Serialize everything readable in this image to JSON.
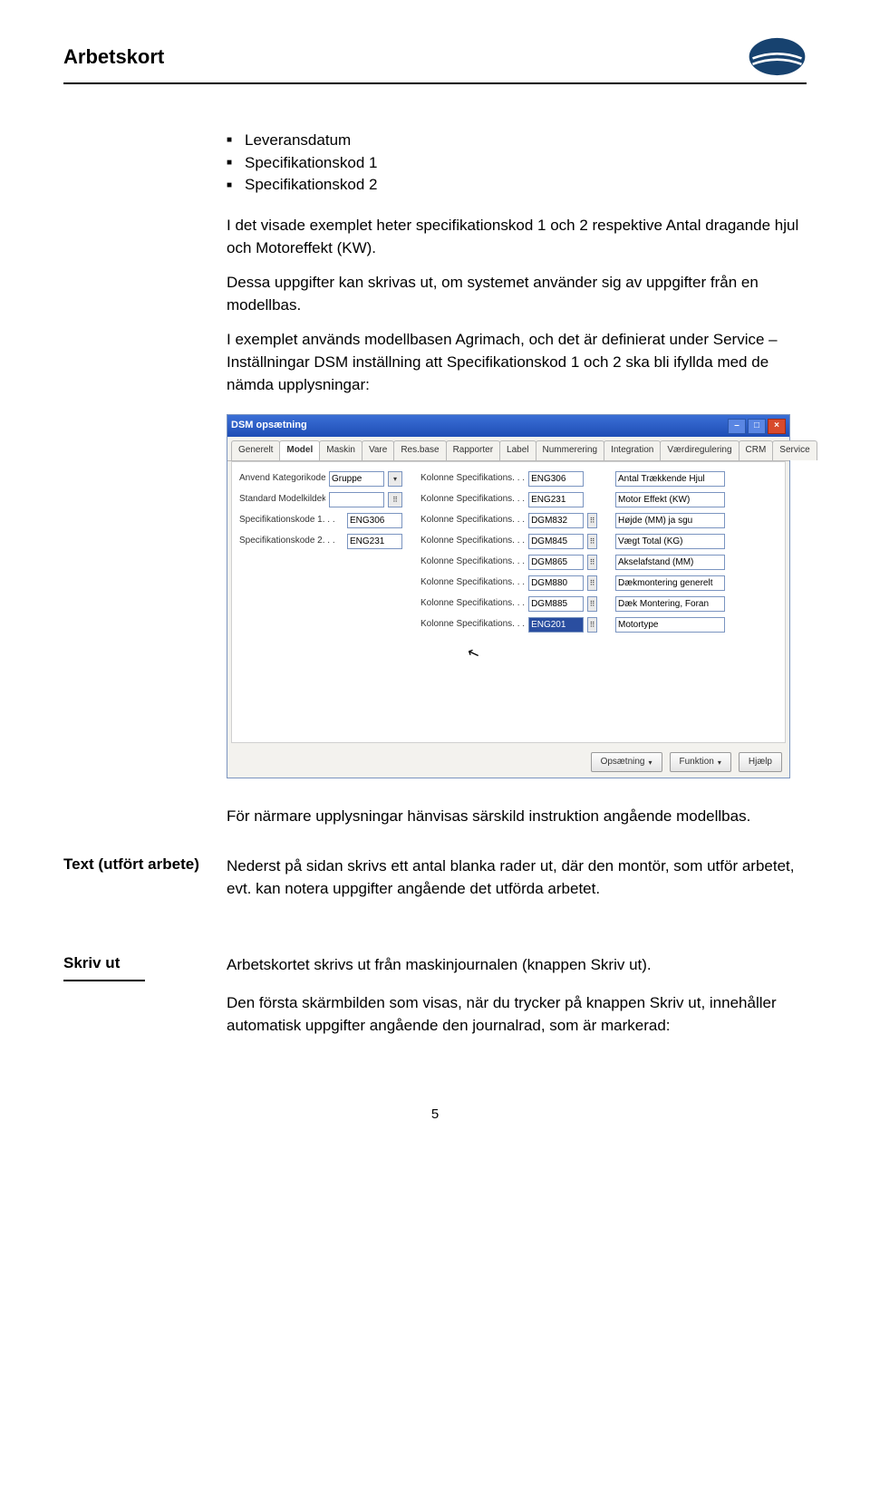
{
  "header": {
    "title": "Arbetskort"
  },
  "bullets": [
    "Leveransdatum",
    "Specifikationskod 1",
    "Specifikationskod 2"
  ],
  "para1": "I det visade exemplet heter specifikationskod 1 och 2 respektive Antal dragande hjul och Motoreffekt (KW).",
  "para2": "Dessa uppgifter kan skrivas ut, om systemet använder sig av uppgifter från en modellbas.",
  "para3": "I exemplet används modellbasen Agrimach, och det är definierat under Service – Inställningar DSM inställning att Specifikationskod 1 och 2 ska bli ifyllda med de nämda upplysningar:",
  "window": {
    "title": "DSM opsætning",
    "tabs": [
      "Generelt",
      "Model",
      "Maskin",
      "Vare",
      "Res.base",
      "Rapporter",
      "Label",
      "Nummerering",
      "Integration",
      "Værdiregulering",
      "CRM",
      "Service"
    ],
    "active_tab": "Model",
    "left_labels": {
      "row1": "Anvend Kategorikode fra",
      "row1_val": "Gruppe",
      "row2": "Standard Modelkildekode",
      "row3": "Specifikationskode 1. . .",
      "row3_val": "ENG306",
      "row4": "Specifikationskode 2. . .",
      "row4_val": "ENG231"
    },
    "mid_label": "Kolonne Specifikations. . .",
    "mid_vals": [
      "ENG306",
      "ENG231",
      "DGM832",
      "DGM845",
      "DGM865",
      "DGM880",
      "DGM885",
      "ENG201"
    ],
    "right_vals": [
      "Antal Trækkende Hjul",
      "Motor Effekt (KW)",
      "Højde (MM) ja sgu",
      "Vægt Total (KG)",
      "Akselafstand (MM)",
      "Dækmontering generelt",
      "Dæk Montering, Foran",
      "Motortype"
    ],
    "buttons": {
      "b1": "Opsætning",
      "b2": "Funktion",
      "b3": "Hjælp"
    }
  },
  "para4": "För närmare upplysningar hänvisas särskild instruktion angående modellbas.",
  "section_text_label": "Text (utfört arbete)",
  "section_text_body": "Nederst på sidan skrivs ett antal blanka rader ut, där den montör, som utför arbetet, evt. kan notera uppgifter angående det utförda arbetet.",
  "section_skriv_label": "Skriv ut",
  "section_skriv_p1": "Arbetskortet skrivs ut från maskinjournalen (knappen Skriv ut).",
  "section_skriv_p2": "Den första skärmbilden som visas, när du trycker på knappen Skriv ut, innehåller automatisk uppgifter angående den journalrad, som är markerad:",
  "page_number": "5"
}
